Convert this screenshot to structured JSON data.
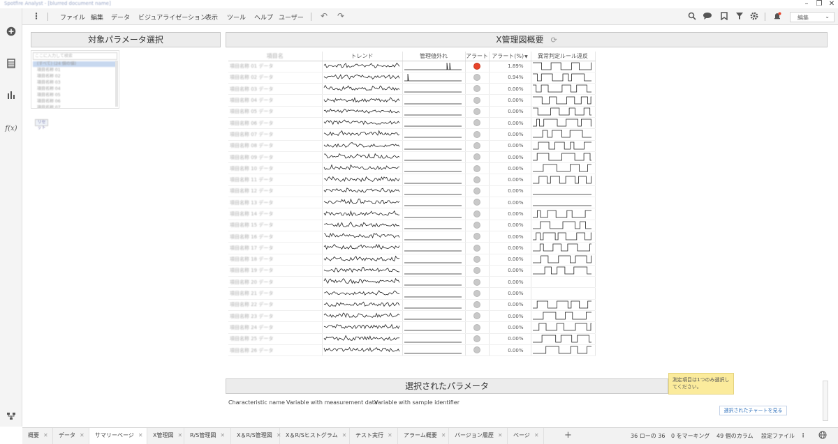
{
  "window": {
    "title_blurred": "Spotfire Analyst - [blurred document name]",
    "minimize": "–",
    "restore": "❐",
    "close": "✕"
  },
  "menu": {
    "items": [
      "ファイル",
      "編集",
      "データ",
      "ビジュアライゼーション",
      "表示",
      "ツール",
      "ヘルプ",
      "ユーザー"
    ],
    "undo": "↶",
    "redo": "↷",
    "edit_mode": "編集"
  },
  "left_panel": {
    "title": "対象パラメータ選択",
    "search_placeholder": "ここに入力して検索",
    "items": [
      "(すべて) (24 個の値)",
      "項目名称 01",
      "項目名称 02",
      "項目名称 03",
      "項目名称 04",
      "項目名称 05",
      "項目名称 06",
      "項目名称 07",
      "項目名称 08"
    ],
    "small_button": "リセット"
  },
  "main_panel": {
    "title": "X管理図概要",
    "headers": {
      "name": "項目名",
      "trend": "トレンド",
      "out_of_limit": "管理値外れ",
      "alert": "アラート",
      "alert_pct": "アラート(%)",
      "rule_violation": "異常判定ルール違反"
    }
  },
  "rows": [
    {
      "name": "項目名称 01 データ",
      "alert": "red",
      "alert_pct": "1.89%",
      "seed": 11
    },
    {
      "name": "項目名称 02 データ",
      "alert": "gray",
      "alert_pct": "0.94%",
      "seed": 23
    },
    {
      "name": "項目名称 03 データ",
      "alert": "gray",
      "alert_pct": "0.00%",
      "seed": 37
    },
    {
      "name": "項目名称 04 データ",
      "alert": "gray",
      "alert_pct": "0.00%",
      "seed": 41
    },
    {
      "name": "項目名称 05 データ",
      "alert": "gray",
      "alert_pct": "0.00%",
      "seed": 53
    },
    {
      "name": "項目名称 06 データ",
      "alert": "gray",
      "alert_pct": "0.00%",
      "seed": 67
    },
    {
      "name": "項目名称 07 データ",
      "alert": "gray",
      "alert_pct": "0.00%",
      "seed": 71
    },
    {
      "name": "項目名称 08 データ",
      "alert": "gray",
      "alert_pct": "0.00%",
      "seed": 83
    },
    {
      "name": "項目名称 09 データ",
      "alert": "gray",
      "alert_pct": "0.00%",
      "seed": 97
    },
    {
      "name": "項目名称 10 データ",
      "alert": "gray",
      "alert_pct": "0.00%",
      "seed": 101
    },
    {
      "name": "項目名称 11 データ",
      "alert": "gray",
      "alert_pct": "0.00%",
      "seed": 113
    },
    {
      "name": "項目名称 12 データ",
      "alert": "gray",
      "alert_pct": "0.00%",
      "seed": 127
    },
    {
      "name": "項目名称 13 データ",
      "alert": "gray",
      "alert_pct": "0.00%",
      "seed": 131
    },
    {
      "name": "項目名称 14 データ",
      "alert": "gray",
      "alert_pct": "0.00%",
      "seed": 149
    },
    {
      "name": "項目名称 15 データ",
      "alert": "gray",
      "alert_pct": "0.00%",
      "seed": 151
    },
    {
      "name": "項目名称 16 データ",
      "alert": "gray",
      "alert_pct": "0.00%",
      "seed": 163
    },
    {
      "name": "項目名称 17 データ",
      "alert": "gray",
      "alert_pct": "0.00%",
      "seed": 173
    },
    {
      "name": "項目名称 18 データ",
      "alert": "gray",
      "alert_pct": "0.00%",
      "seed": 181
    },
    {
      "name": "項目名称 19 データ",
      "alert": "gray",
      "alert_pct": "0.00%",
      "seed": 191
    },
    {
      "name": "項目名称 20 データ",
      "alert": "gray",
      "alert_pct": "0.00%",
      "seed": 199
    },
    {
      "name": "項目名称 21 データ",
      "alert": "gray",
      "alert_pct": "0.00%",
      "seed": 211
    },
    {
      "name": "項目名称 22 データ",
      "alert": "gray",
      "alert_pct": "0.00%",
      "seed": 223
    },
    {
      "name": "項目名称 23 データ",
      "alert": "gray",
      "alert_pct": "0.00%",
      "seed": 227
    },
    {
      "name": "項目名称 24 データ",
      "alert": "gray",
      "alert_pct": "0.00%",
      "seed": 239
    },
    {
      "name": "項目名称 25 データ",
      "alert": "gray",
      "alert_pct": "0.00%",
      "seed": 241
    },
    {
      "name": "項目名称 26 データ",
      "alert": "gray",
      "alert_pct": "0.00%",
      "seed": 251
    }
  ],
  "selected_panel": {
    "title": "選択されたパラメータ",
    "columns": [
      "Characteristic name",
      "Variable with measurement data",
      "Variable with sample identifier"
    ],
    "tooltip": "測定項目は1つのみ選択してください。",
    "link_button": "選択されたチャートを見る"
  },
  "tabs": [
    "概要",
    "データ",
    "サマリーページ",
    "X管理図",
    "R/S管理図",
    "X＆R/S管理図",
    "X＆R/Sヒストグラム",
    "テスト実行",
    "アラーム概要",
    "バージョン履歴",
    "ページ"
  ],
  "active_tab": "サマリーページ",
  "status": {
    "rows": "36 ローの 36",
    "marking": "0 をマーキング",
    "columns": "49 個のカラム",
    "settings": "設定ファイル"
  },
  "colors": {
    "alert_red": "#e8432a",
    "alert_gray": "#c9c9c9",
    "tooltip": "#fbeb9c",
    "link": "#2a6ebb"
  }
}
